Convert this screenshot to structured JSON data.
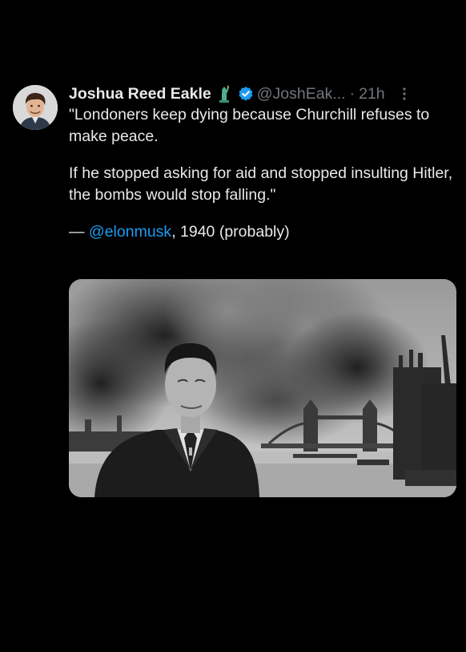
{
  "tweet": {
    "display_name": "Joshua Reed Eakle",
    "emoji_icon": "statue-of-liberty-icon",
    "verified_icon": "verified-badge-icon",
    "handle": "@JoshEak...",
    "separator": "·",
    "time": "21h",
    "more_icon": "more-options-icon",
    "text": {
      "line1": "\"Londoners keep dying because Churchill refuses to make peace.",
      "line2": "If he stopped asking for aid and stopped insulting Hitler, the bombs would stop falling.\"",
      "attribution_prefix": "— ",
      "mention": "@elonmusk",
      "attribution_suffix": ", 1940 (probably)"
    },
    "media": {
      "type": "photo",
      "subject": "man in dark suit in front of burning London with Tower Bridge"
    }
  },
  "colors": {
    "background": "#000000",
    "text": "#e7e9ea",
    "secondary": "#71767b",
    "accent": "#1d9bf0"
  }
}
